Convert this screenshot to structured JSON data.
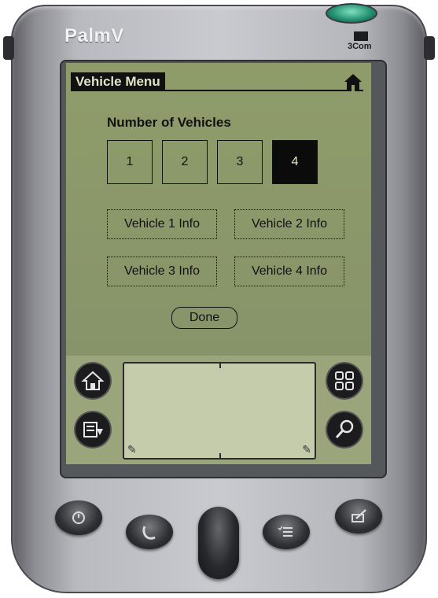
{
  "device": {
    "brand": "PalmV",
    "maker_logo": "3Com"
  },
  "header": {
    "title": "Vehicle Menu",
    "home_icon": "home-icon"
  },
  "main": {
    "heading": "Number of Vehicles",
    "counts": [
      {
        "label": "1",
        "selected": false
      },
      {
        "label": "2",
        "selected": false
      },
      {
        "label": "3",
        "selected": false
      },
      {
        "label": "4",
        "selected": true
      }
    ],
    "vehicle_buttons": [
      "Vehicle 1 Info",
      "Vehicle 2 Info",
      "Vehicle 3 Info",
      "Vehicle 4 Info"
    ],
    "done_label": "Done"
  },
  "silkscreen": {
    "left_icons": [
      "home-icon",
      "menu-icon"
    ],
    "right_icons": [
      "applications-icon",
      "find-icon"
    ]
  },
  "hardware_buttons": [
    "date-book-icon",
    "phone-book-icon",
    "todo-list-icon",
    "memo-pad-icon"
  ],
  "colors": {
    "lcd": "#8b9868",
    "ink": "#111111",
    "selected_fill": "#0b0b0b"
  }
}
